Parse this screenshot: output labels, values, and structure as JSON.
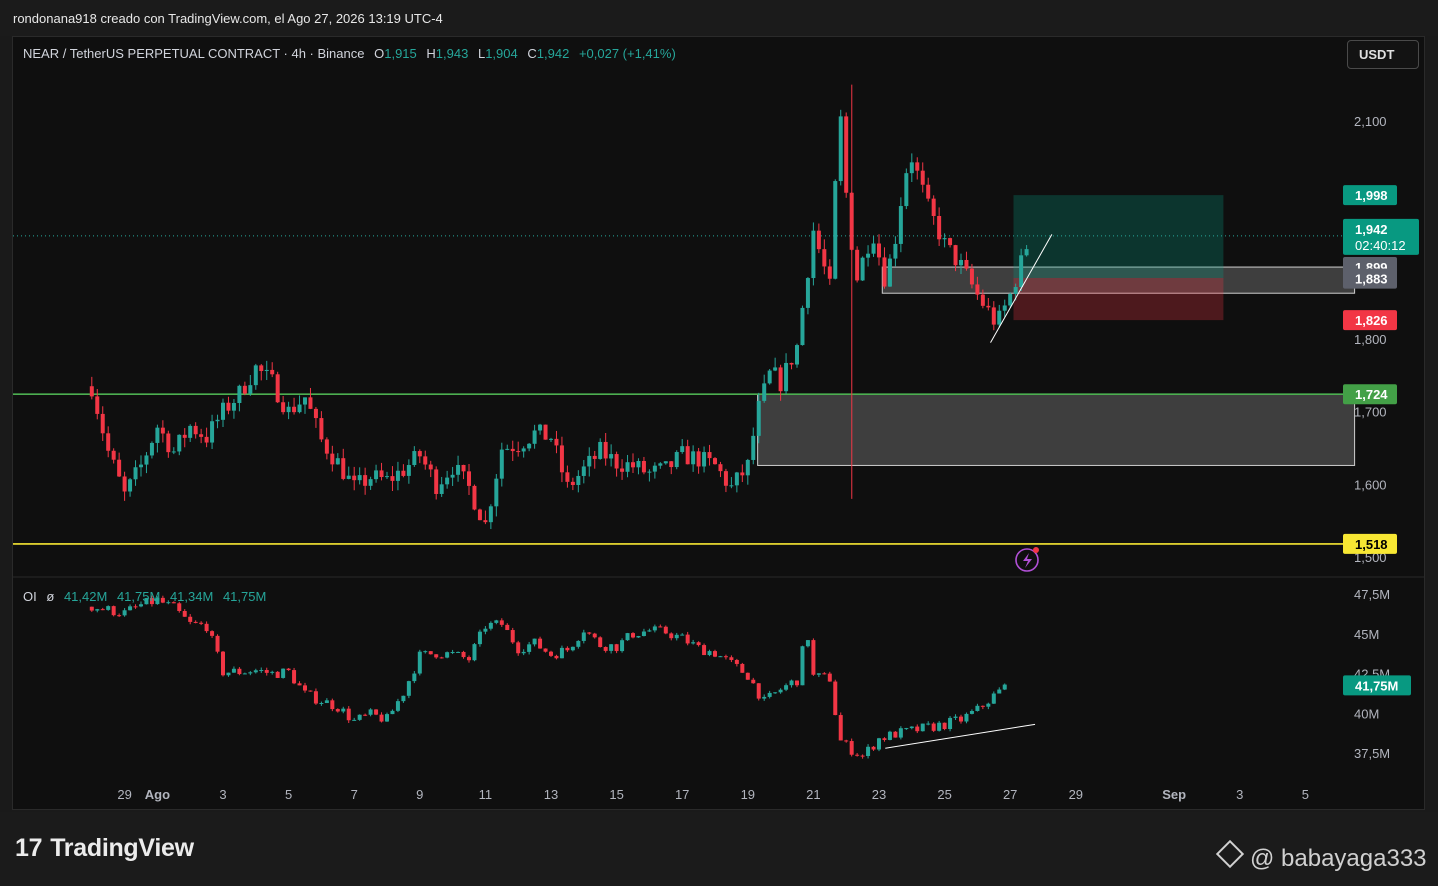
{
  "header": {
    "credit": "rondonana918 creado con TradingView.com, el Ago 27, 2026 13:19 UTC-4"
  },
  "legend": {
    "symbol": "NEAR / TetherUS PERPETUAL CONTRACT · 4h · Binance",
    "o_label": "O",
    "open": "1,915",
    "h_label": "H",
    "high": "1,943",
    "l_label": "L",
    "low": "1,904",
    "c_label": "C",
    "close": "1,942",
    "change": "+0,027 (+1,41%)"
  },
  "currency_button": "USDT",
  "oi_legend": {
    "label": "OI",
    "symbol": "ø",
    "v1": "41,42M",
    "v2": "41,75M",
    "v3": "41,34M",
    "v4": "41,75M"
  },
  "branding": {
    "logo_mark": "17",
    "logo_text": "TradingView",
    "watermark": "@ babayaga333"
  },
  "colors": {
    "up": "#26a69a",
    "down": "#f23645",
    "support": "#4caf50",
    "yellow": "#f7e733"
  },
  "chart_data": [
    {
      "type": "candlestick",
      "title": "NEAR / TetherUS PERPETUAL CONTRACT · 4h · Binance",
      "ylim": [
        1.495,
        2.245
      ],
      "y_ticks": [
        {
          "v": 2.1,
          "label": "2,100"
        },
        {
          "v": 1.8,
          "label": "1,800"
        },
        {
          "v": 1.7,
          "label": "1,700"
        },
        {
          "v": 1.6,
          "label": "1,600"
        },
        {
          "v": 1.5,
          "label": "1,500"
        }
      ],
      "x_ticks": [
        {
          "label": "29",
          "day": -3
        },
        {
          "label": "Ago",
          "day": -2
        },
        {
          "label": "3",
          "day": 0
        },
        {
          "label": "5",
          "day": 2
        },
        {
          "label": "7",
          "day": 4
        },
        {
          "label": "9",
          "day": 6
        },
        {
          "label": "11",
          "day": 8
        },
        {
          "label": "13",
          "day": 10
        },
        {
          "label": "15",
          "day": 12
        },
        {
          "label": "17",
          "day": 14
        },
        {
          "label": "19",
          "day": 16
        },
        {
          "label": "21",
          "day": 18
        },
        {
          "label": "23",
          "day": 20
        },
        {
          "label": "25",
          "day": 22
        },
        {
          "label": "27",
          "day": 24
        },
        {
          "label": "29",
          "day": 26
        },
        {
          "label": "Sep",
          "day": 29
        },
        {
          "label": "3",
          "day": 31
        },
        {
          "label": "5",
          "day": 33
        }
      ],
      "price_badges": [
        {
          "label": "1,998",
          "v": 1.998,
          "color": "#089981"
        },
        {
          "label": "1,942",
          "sub": "02:40:12",
          "v": 1.942,
          "color": "#089981"
        },
        {
          "label": "1,899",
          "v": 1.899,
          "color": "#5d606b"
        },
        {
          "label": "1,883",
          "v": 1.883,
          "color": "#5d606b"
        },
        {
          "label": "1,826",
          "v": 1.826,
          "color": "#f23645"
        },
        {
          "label": "1,724",
          "v": 1.724,
          "color": "#43a047"
        },
        {
          "label": "1,518",
          "v": 1.518,
          "color": "#f7e733"
        }
      ],
      "horizontal_lines": [
        {
          "v": 1.724,
          "color": "#4caf50"
        },
        {
          "v": 1.518,
          "color": "#f7e733"
        },
        {
          "v": 1.942,
          "color": "#26a69a",
          "style": "dotted"
        }
      ],
      "zones": [
        {
          "day_from": 16.3,
          "day_to": 34.5,
          "top": 1.724,
          "bottom": 1.626,
          "kind": "range"
        },
        {
          "day_from": 20.1,
          "day_to": 34.5,
          "top": 1.899,
          "bottom": 1.863,
          "kind": "range"
        },
        {
          "day_from": 24.1,
          "day_to": 30.5,
          "top": 1.998,
          "bottom": 1.884,
          "kind": "target"
        },
        {
          "day_from": 24.1,
          "day_to": 30.5,
          "top": 1.884,
          "bottom": 1.826,
          "kind": "stop"
        }
      ],
      "trendline": {
        "from": {
          "day": 23.4,
          "v": 1.795
        },
        "to": {
          "day": 24.6,
          "v": 1.933
        }
      },
      "anchors": [
        [
          -4.0,
          1.735
        ],
        [
          -3.5,
          1.645
        ],
        [
          -3.0,
          1.585
        ],
        [
          -2.5,
          1.625
        ],
        [
          -2.0,
          1.68
        ],
        [
          -1.5,
          1.645
        ],
        [
          -1.0,
          1.68
        ],
        [
          -0.5,
          1.665
        ],
        [
          0.0,
          1.7
        ],
        [
          0.5,
          1.725
        ],
        [
          1.0,
          1.76
        ],
        [
          1.5,
          1.74
        ],
        [
          2.0,
          1.7
        ],
        [
          2.5,
          1.72
        ],
        [
          3.0,
          1.66
        ],
        [
          3.5,
          1.63
        ],
        [
          4.0,
          1.595
        ],
        [
          4.5,
          1.61
        ],
        [
          5.0,
          1.605
        ],
        [
          5.5,
          1.62
        ],
        [
          6.0,
          1.64
        ],
        [
          6.5,
          1.6
        ],
        [
          7.0,
          1.625
        ],
        [
          7.5,
          1.595
        ],
        [
          8.0,
          1.545
        ],
        [
          8.5,
          1.65
        ],
        [
          9.0,
          1.655
        ],
        [
          9.5,
          1.67
        ],
        [
          10.0,
          1.665
        ],
        [
          10.5,
          1.595
        ],
        [
          11.0,
          1.62
        ],
        [
          11.5,
          1.645
        ],
        [
          12.0,
          1.63
        ],
        [
          12.5,
          1.625
        ],
        [
          13.0,
          1.615
        ],
        [
          13.5,
          1.62
        ],
        [
          14.0,
          1.64
        ],
        [
          14.5,
          1.635
        ],
        [
          15.0,
          1.625
        ],
        [
          15.5,
          1.595
        ],
        [
          16.0,
          1.625
        ],
        [
          16.3,
          1.7
        ],
        [
          16.7,
          1.755
        ],
        [
          17.0,
          1.74
        ],
        [
          17.5,
          1.79
        ],
        [
          18.0,
          1.95
        ],
        [
          18.5,
          1.87
        ],
        [
          18.8,
          2.12
        ],
        [
          19.0,
          2.0
        ],
        [
          19.3,
          1.88
        ],
        [
          19.8,
          1.95
        ],
        [
          20.2,
          1.88
        ],
        [
          20.5,
          1.94
        ],
        [
          20.8,
          2.03
        ],
        [
          21.0,
          2.05
        ],
        [
          21.5,
          1.98
        ],
        [
          22.0,
          1.93
        ],
        [
          22.5,
          1.9
        ],
        [
          23.0,
          1.86
        ],
        [
          23.3,
          1.84
        ],
        [
          23.6,
          1.82
        ],
        [
          24.0,
          1.86
        ],
        [
          24.3,
          1.9
        ],
        [
          24.6,
          1.942
        ]
      ],
      "anomaly": {
        "day": 19.17,
        "high": 2.15,
        "low": 1.58
      }
    },
    {
      "type": "candlestick",
      "title": "OI ø",
      "ylim": [
        36.5,
        48.4
      ],
      "y_ticks": [
        {
          "v": 47.5,
          "label": "47,5M"
        },
        {
          "v": 45.0,
          "label": "45M"
        },
        {
          "v": 42.5,
          "label": "42,5M"
        },
        {
          "v": 40.0,
          "label": "40M"
        },
        {
          "v": 37.5,
          "label": "37,5M"
        }
      ],
      "badge": {
        "label": "41,75M",
        "v": 41.75,
        "color": "#089981"
      },
      "trendline": {
        "from": {
          "day": 20.1,
          "v": 37.8
        },
        "to": {
          "day": 24.3,
          "v": 39.3
        }
      },
      "anchors": [
        [
          -4.0,
          46.7
        ],
        [
          -3.5,
          46.5
        ],
        [
          -3.0,
          46.3
        ],
        [
          -2.5,
          46.8
        ],
        [
          -2.0,
          47.1
        ],
        [
          -1.5,
          46.6
        ],
        [
          -1.0,
          45.6
        ],
        [
          -0.5,
          45.5
        ],
        [
          0.0,
          42.6
        ],
        [
          0.5,
          42.6
        ],
        [
          1.0,
          42.7
        ],
        [
          1.5,
          42.5
        ],
        [
          2.0,
          42.6
        ],
        [
          2.5,
          41.2
        ],
        [
          3.0,
          40.8
        ],
        [
          3.5,
          40.4
        ],
        [
          4.0,
          39.5
        ],
        [
          4.5,
          39.9
        ],
        [
          5.0,
          39.6
        ],
        [
          5.5,
          41.3
        ],
        [
          6.0,
          43.6
        ],
        [
          6.5,
          43.8
        ],
        [
          7.0,
          43.7
        ],
        [
          7.5,
          43.4
        ],
        [
          8.0,
          45.5
        ],
        [
          8.5,
          45.6
        ],
        [
          9.0,
          44.1
        ],
        [
          9.5,
          44.4
        ],
        [
          10.0,
          43.7
        ],
        [
          10.5,
          44.0
        ],
        [
          11.0,
          45.3
        ],
        [
          11.5,
          44.3
        ],
        [
          12.0,
          44.2
        ],
        [
          12.5,
          45.0
        ],
        [
          13.0,
          45.2
        ],
        [
          13.5,
          45.1
        ],
        [
          14.0,
          44.7
        ],
        [
          14.5,
          44.1
        ],
        [
          15.0,
          43.8
        ],
        [
          15.5,
          43.1
        ],
        [
          16.0,
          42.4
        ],
        [
          16.5,
          40.7
        ],
        [
          17.0,
          41.5
        ],
        [
          17.5,
          42.1
        ],
        [
          17.8,
          45.3
        ],
        [
          18.0,
          42.3
        ],
        [
          18.5,
          42.2
        ],
        [
          18.8,
          38.3
        ],
        [
          19.1,
          37.8
        ],
        [
          19.5,
          37.3
        ],
        [
          20.0,
          38.4
        ],
        [
          20.5,
          38.7
        ],
        [
          21.0,
          38.9
        ],
        [
          21.5,
          39.1
        ],
        [
          22.0,
          39.3
        ],
        [
          22.5,
          39.6
        ],
        [
          23.0,
          40.2
        ],
        [
          23.5,
          41.1
        ],
        [
          23.9,
          41.75
        ]
      ]
    }
  ]
}
